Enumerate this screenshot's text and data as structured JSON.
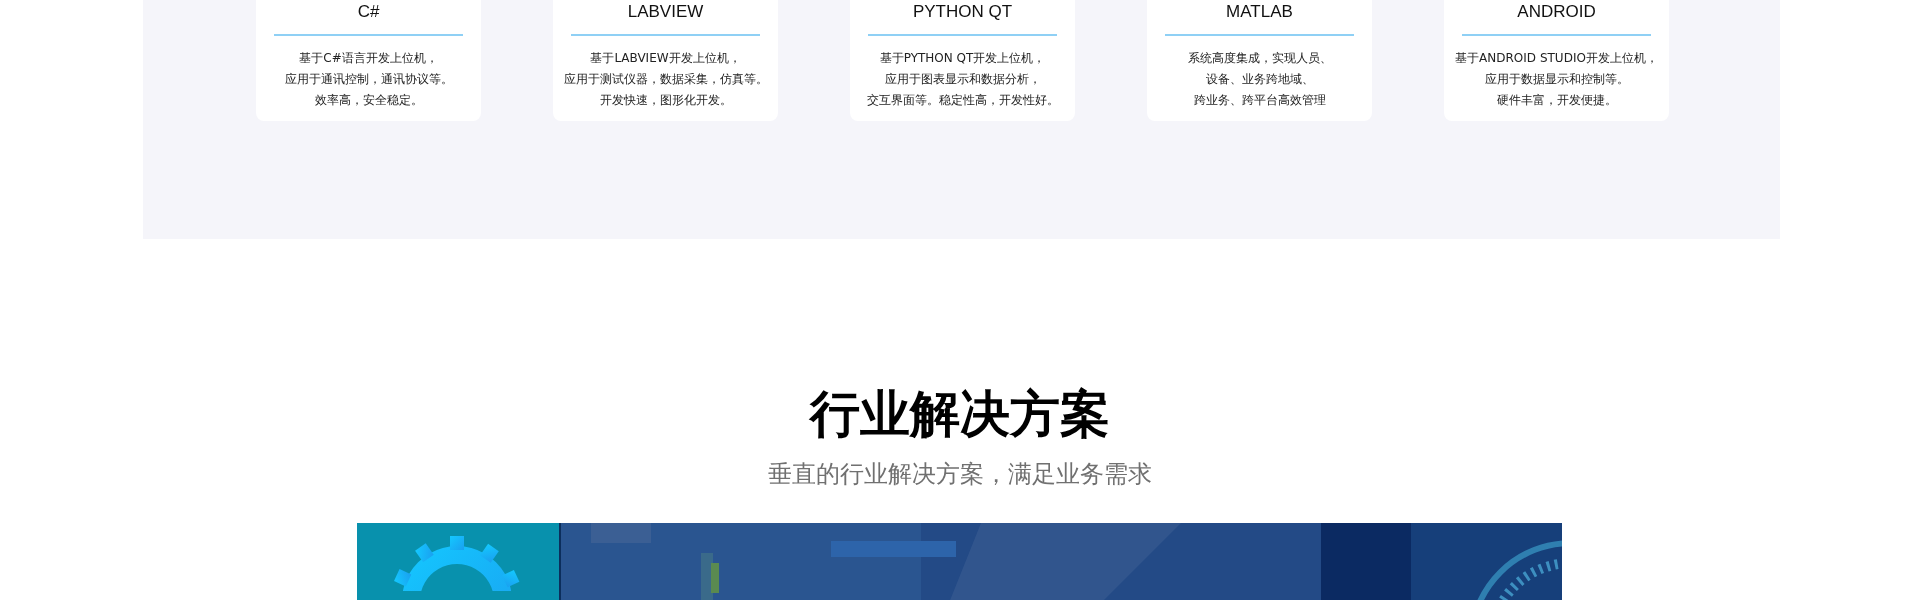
{
  "platforms": [
    {
      "title": "C#",
      "lines": [
        "基于C#语言开发上位机，",
        "应用于通讯控制，通讯协议等。",
        "效率高，安全稳定。"
      ]
    },
    {
      "title": "LABVIEW",
      "lines": [
        "基于LABVIEW开发上位机，",
        "应用于测试仪器，数据采集，仿真等。",
        "开发快速，图形化开发。"
      ]
    },
    {
      "title": "PYTHON QT",
      "lines": [
        "基于PYTHON QT开发上位机，",
        "应用于图表显示和数据分析，",
        "交互界面等。稳定性高，开发性好。"
      ]
    },
    {
      "title": "MATLAB",
      "lines": [
        "系统高度集成，实现人员、",
        "设备、业务跨地域、",
        "跨业务、跨平台高效管理"
      ]
    },
    {
      "title": "ANDROID",
      "lines": [
        "基于ANDROID STUDIO开发上位机，",
        "应用于数据显示和控制等。",
        "硬件丰富，开发便捷。"
      ]
    }
  ],
  "solutions": {
    "title": "行业解决方案",
    "subtitle": "垂直的行业解决方案，满足业务需求"
  }
}
